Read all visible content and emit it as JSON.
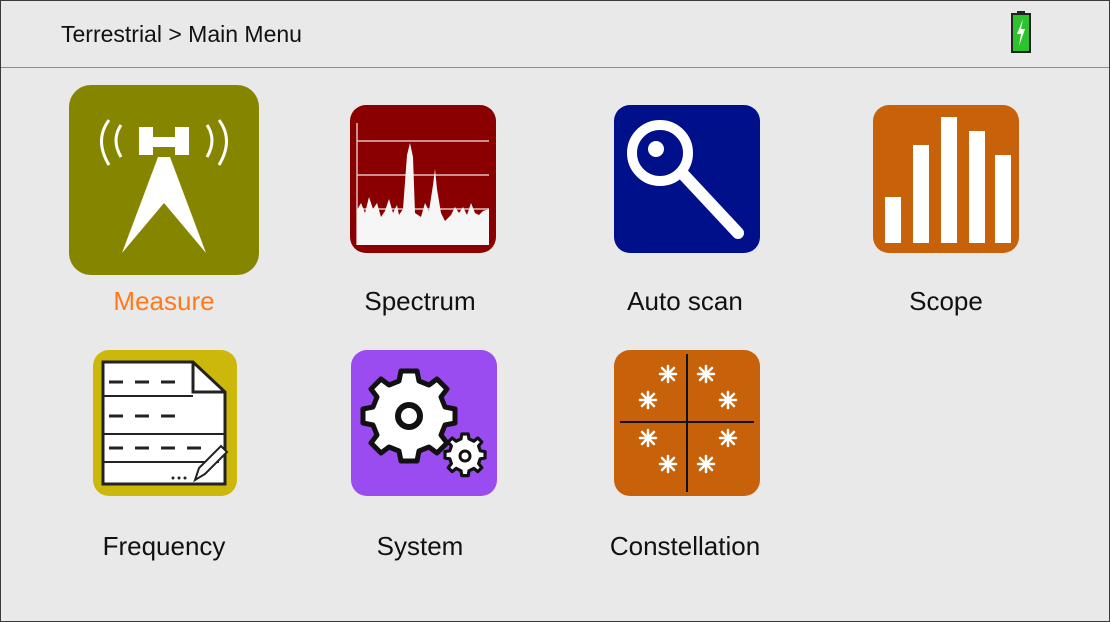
{
  "header": {
    "breadcrumb": "Terrestrial > Main Menu",
    "battery_icon": "battery-charging-icon"
  },
  "colors": {
    "header_divider": "#5b9bd5",
    "selected_label": "#ff7a1a",
    "measure": "#858500",
    "spectrum": "#8a0000",
    "autoscan": "#00108a",
    "scope": "#c8620a",
    "frequency": "#cbb80a",
    "system": "#9b4cf0",
    "constellation": "#c8620a"
  },
  "menu": {
    "selected": "Measure",
    "items": [
      {
        "label": "Measure",
        "icon": "antenna-tower-icon"
      },
      {
        "label": "Spectrum",
        "icon": "spectrum-graph-icon"
      },
      {
        "label": "Auto scan",
        "icon": "magnifier-icon"
      },
      {
        "label": "Scope",
        "icon": "bar-chart-icon"
      },
      {
        "label": "Frequency",
        "icon": "frequency-list-icon"
      },
      {
        "label": "System",
        "icon": "gears-icon"
      },
      {
        "label": "Constellation",
        "icon": "constellation-icon"
      }
    ]
  }
}
